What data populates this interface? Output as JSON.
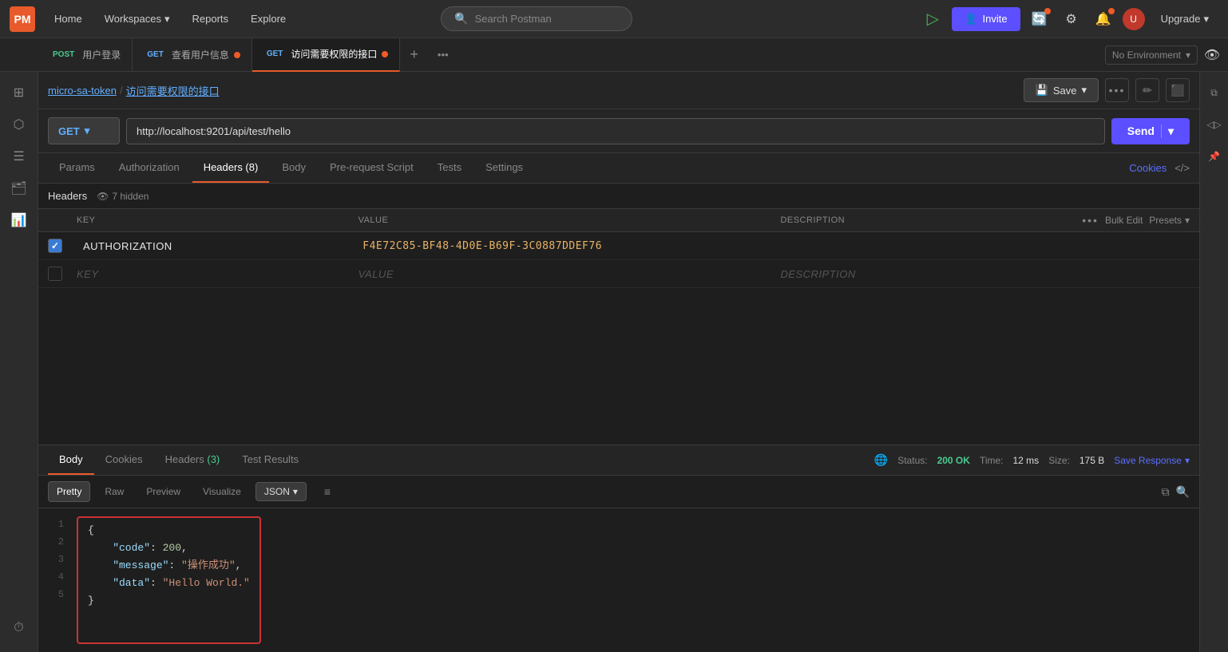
{
  "app": {
    "logo": "PM",
    "nav": {
      "home": "Home",
      "workspaces": "Workspaces",
      "reports": "Reports",
      "explore": "Explore"
    },
    "search": {
      "placeholder": "Search Postman"
    },
    "buttons": {
      "invite": "Invite",
      "upgrade": "Upgrade"
    }
  },
  "tabs": [
    {
      "method": "POST",
      "label": "用户登录",
      "active": false,
      "has_dot": false
    },
    {
      "method": "GET",
      "label": "查看用户信息",
      "active": false,
      "has_dot": true
    },
    {
      "method": "GET",
      "label": "访问需要权限的接口",
      "active": true,
      "has_dot": true
    }
  ],
  "environment": {
    "label": "No Environment"
  },
  "breadcrumb": {
    "parent": "micro-sa-token",
    "separator": "/",
    "current": "访问需要权限的接口"
  },
  "request": {
    "method": "GET",
    "url": "http://localhost:9201/api/test/hello",
    "send_button": "Send"
  },
  "request_tabs": {
    "items": [
      "Params",
      "Authorization",
      "Headers (8)",
      "Body",
      "Pre-request Script",
      "Tests",
      "Settings"
    ],
    "active": "Headers (8)",
    "cookies": "Cookies"
  },
  "headers": {
    "label": "Headers",
    "hidden": "7 hidden",
    "columns": {
      "key": "KEY",
      "value": "VALUE",
      "description": "DESCRIPTION"
    },
    "bulk_edit": "Bulk Edit",
    "presets": "Presets",
    "rows": [
      {
        "checked": true,
        "key": "Authorization",
        "value": "f4e72c85-bf48-4d0e-b69f-3c0887ddef76",
        "description": ""
      }
    ],
    "empty_row": {
      "key": "Key",
      "value": "Value",
      "description": "Description"
    }
  },
  "response": {
    "tabs": [
      "Body",
      "Cookies",
      "Headers (3)",
      "Test Results"
    ],
    "active_tab": "Body",
    "status": "200 OK",
    "time": "12 ms",
    "size": "175 B",
    "save_response": "Save Response",
    "format_tabs": [
      "Pretty",
      "Raw",
      "Preview",
      "Visualize"
    ],
    "active_format": "Pretty",
    "format_type": "JSON",
    "code_lines": [
      "{",
      "    \"code\": 200,",
      "    \"message\": \"操作成功\",",
      "    \"data\": \"Hello World.\"",
      "}"
    ]
  },
  "sidebar": {
    "icons": [
      {
        "name": "layout-icon",
        "symbol": "⊞"
      },
      {
        "name": "nodes-icon",
        "symbol": "⬡"
      },
      {
        "name": "history-icon",
        "symbol": "☰"
      },
      {
        "name": "book-icon",
        "symbol": "📋"
      },
      {
        "name": "chart-icon",
        "symbol": "📊"
      },
      {
        "name": "clock-icon",
        "symbol": "⏱"
      }
    ]
  }
}
